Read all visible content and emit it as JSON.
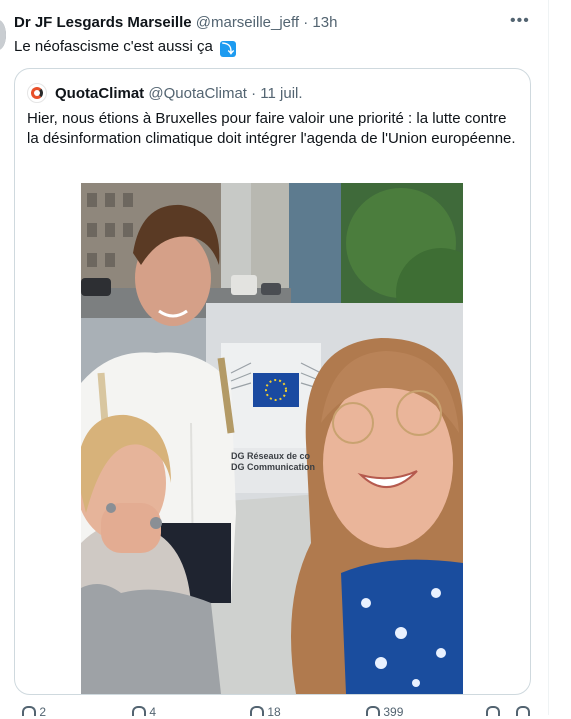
{
  "tweet": {
    "author_name": "Dr JF Lesgards Marseille",
    "author_handle": "@marseille_jeff",
    "separator": "·",
    "time": "13h",
    "text": "Le néofascisme c'est aussi ça",
    "emoji": "⤵",
    "more_icon": "more-horizontal-icon"
  },
  "quote": {
    "author_name": "QuotaClimat",
    "author_handle": "@QuotaClimat",
    "separator": "·",
    "date": "11 juil.",
    "text": "Hier, nous étions à Bruxelles pour faire valoir une priorité : la lutte contre la désinformation climatique doit intégrer l'agenda de l'Union européenne.",
    "photo": {
      "sign_line1": "DG Réseaux de co",
      "sign_line2": "DG Communication"
    }
  },
  "actions": {
    "reply_count": "2",
    "retweet_count": "4",
    "like_count": "18",
    "views_count": "399"
  },
  "colors": {
    "accent": "#1d9bf0",
    "text": "#0f1419",
    "muted": "#536471",
    "border": "#cfd9de"
  }
}
